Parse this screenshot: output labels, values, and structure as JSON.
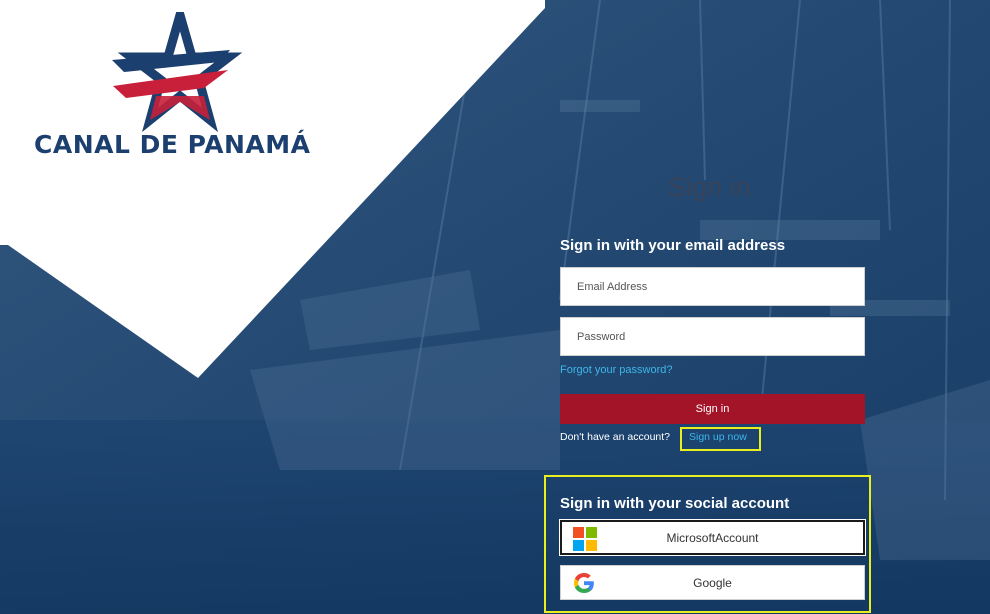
{
  "brand": {
    "name": "CANAL DE PANAMÁ",
    "colors": {
      "navy": "#1b3f6e",
      "red": "#c8203a",
      "blue": "#22477a"
    }
  },
  "page": {
    "heading": "Sign in"
  },
  "email_login": {
    "title": "Sign in with your email address",
    "email_placeholder": "Email Address",
    "password_placeholder": "Password",
    "forgot_link": "Forgot your password?",
    "sign_in_button": "Sign in",
    "no_account_text": "Don't have an account?",
    "sign_up_link": "Sign up now"
  },
  "social_login": {
    "title": "Sign in with your social account",
    "providers": [
      {
        "label": "MicrosoftAccount",
        "icon": "microsoft-logo-icon"
      },
      {
        "label": "Google",
        "icon": "google-logo-icon"
      }
    ]
  },
  "colors": {
    "primary_button": "#a41429",
    "link": "#3fb6e8",
    "highlight_outline": "#e8ef1e",
    "overlay": "#1e4773"
  }
}
